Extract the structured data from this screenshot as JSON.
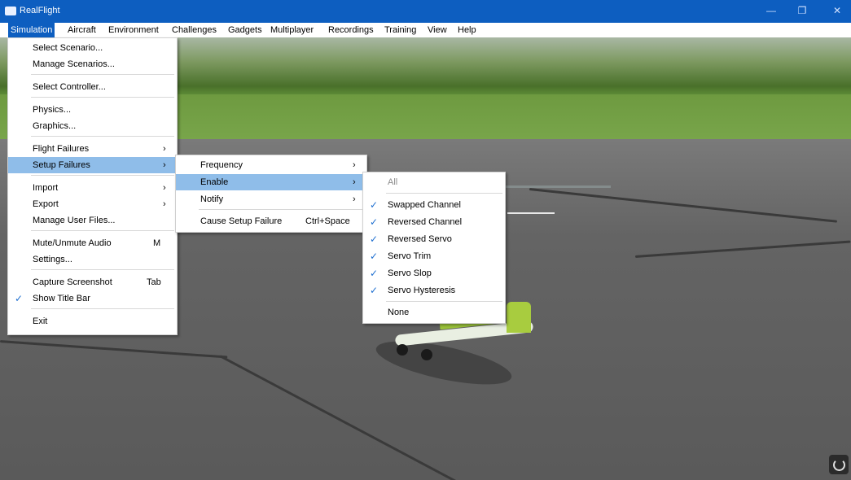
{
  "titlebar": {
    "title": "RealFlight",
    "min_icon": "minimize-icon",
    "max_icon": "restore-icon",
    "close_icon": "close-icon",
    "min_label": "—",
    "max_label": "❐",
    "close_label": "✕"
  },
  "menubar": {
    "items": [
      "Simulation",
      "Aircraft",
      "Environment",
      "Challenges",
      "Gadgets",
      "Multiplayer",
      "Recordings",
      "Training",
      "View",
      "Help"
    ],
    "active": "Simulation"
  },
  "simulation_menu": {
    "items": [
      {
        "label": "Select Scenario..."
      },
      {
        "label": "Manage Scenarios..."
      },
      {
        "label": "Select Controller..."
      },
      {
        "label": "Physics..."
      },
      {
        "label": "Graphics..."
      },
      {
        "label": "Flight Failures",
        "submenu": true
      },
      {
        "label": "Setup Failures",
        "submenu": true,
        "highlighted": true
      },
      {
        "label": "Import",
        "submenu": true
      },
      {
        "label": "Export",
        "submenu": true
      },
      {
        "label": "Manage User Files..."
      },
      {
        "label": "Mute/Unmute Audio",
        "shortcut": "M"
      },
      {
        "label": "Settings..."
      },
      {
        "label": "Capture Screenshot",
        "shortcut": "Tab"
      },
      {
        "label": "Show Title Bar",
        "checked": true
      },
      {
        "label": "Exit"
      }
    ]
  },
  "setup_failures_menu": {
    "items": [
      {
        "label": "Frequency",
        "submenu": true
      },
      {
        "label": "Enable",
        "submenu": true,
        "highlighted": true
      },
      {
        "label": "Notify",
        "submenu": true
      },
      {
        "label": "Cause Setup Failure",
        "shortcut": "Ctrl+Space"
      }
    ]
  },
  "enable_menu": {
    "items": [
      {
        "label": "All",
        "disabled": true
      },
      {
        "label": "Swapped Channel",
        "checked": true
      },
      {
        "label": "Reversed Channel",
        "checked": true
      },
      {
        "label": "Reversed Servo",
        "checked": true
      },
      {
        "label": "Servo Trim",
        "checked": true
      },
      {
        "label": "Servo Slop",
        "checked": true
      },
      {
        "label": "Servo Hysteresis",
        "checked": true
      },
      {
        "label": "None"
      }
    ]
  },
  "glyphs": {
    "arrow": "›",
    "check": "✓"
  },
  "colors": {
    "titlebar": "#0d5ec0",
    "highlight": "#8fbde9",
    "check": "#1e6fd0"
  }
}
